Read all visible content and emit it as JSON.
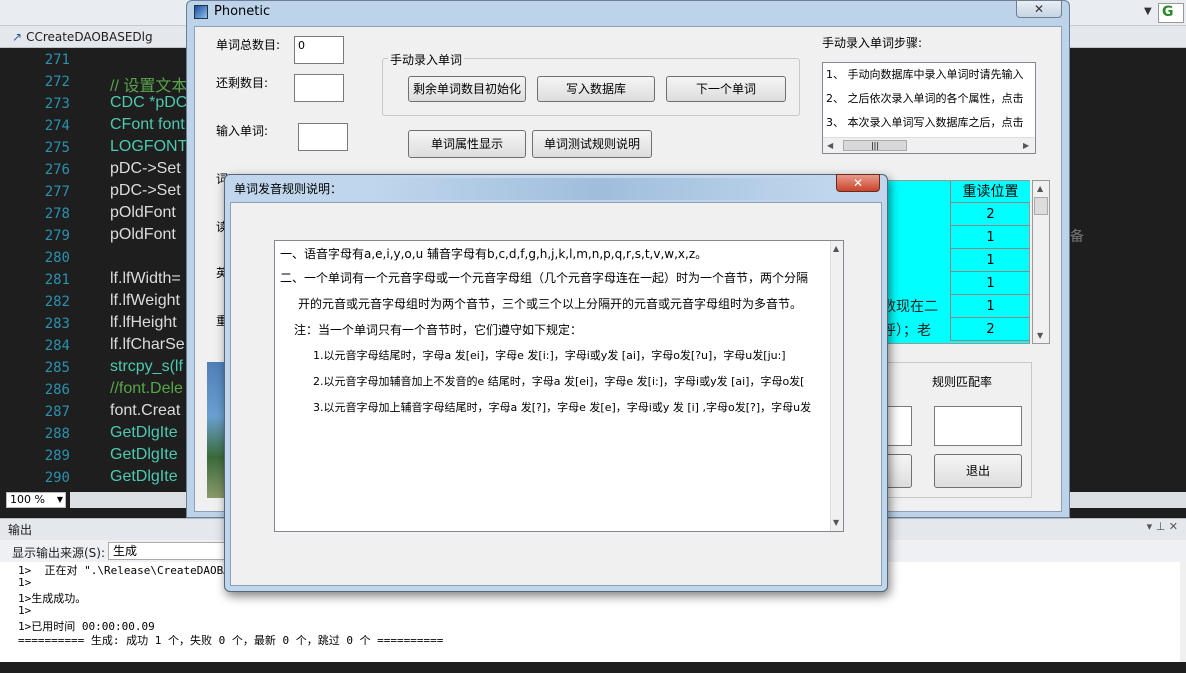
{
  "ide": {
    "file_tab": "CCreateDAOBASEDlg",
    "line_numbers": [
      "271",
      "272",
      "273",
      "274",
      "275",
      "276",
      "277",
      "278",
      "279",
      "280",
      "281",
      "282",
      "283",
      "284",
      "285",
      "286",
      "287",
      "288",
      "289",
      "290"
    ],
    "code_lines": [
      "",
      "// 设置文本",
      "CDC *pDC",
      "CFont font",
      "LOGFONT",
      "pDC->Set",
      "pDC->Set",
      "pOldFont",
      "pOldFont",
      "",
      "lf.lfWidth=",
      "lf.lfWeight",
      "lf.lfHeight",
      "lf.lfCharSe",
      "strcpy_s(lf",
      "//font.Dele",
      "font.Creat",
      "GetDlgIte",
      "GetDlgIte",
      "GetDlgIte"
    ],
    "zoom": "100 %",
    "right_hint": "备",
    "output": {
      "title": "输出",
      "controls": "▾ ⊥ ✕",
      "source_label": "显示输出来源(S):",
      "source_value": "生成",
      "lines": [
        "1>  正在对 \".\\Release\\CreateDAOBASE...",
        "1>",
        "1>生成成功。",
        "1>",
        "1>已用时间 00:00:00.09",
        "========== 生成: 成功 1 个，失败 0 个，最新 0 个，跳过 0 个 =========="
      ]
    }
  },
  "phonetic": {
    "title": "Phonetic",
    "close": "✕",
    "total_label": "单词总数目:",
    "total_value": "0",
    "remaining_label": "还剩数目:",
    "remaining_value": "",
    "input_label": "输入单词:",
    "input_value": "",
    "group_label": "手动录入单词",
    "btn_init": "剩余单词数目初始化",
    "btn_write": "写入数据库",
    "btn_next": "下一个单词",
    "btn_attr": "单词属性显示",
    "btn_rules": "单词测试规则说明",
    "steps_label": "手动录入单词步骤:",
    "steps": [
      "1、 手动向数据库中录入单词时请先输入",
      "2、 之后依次录入单词的各个属性，点击",
      "3、 本次录入单词写入数据库之后，点击"
    ],
    "grid_header": "重读位置",
    "grid_values": [
      "2",
      "1",
      "1",
      "1",
      "1",
      "2"
    ],
    "hidden_text": "数现在二",
    "hidden_text2": "呼）；老",
    "match_label": "规则匹配率",
    "match_value": "",
    "btn_exit": "退出"
  },
  "rule_dialog": {
    "title": "单词发音规则说明：",
    "close": "✕",
    "lines": [
      "一、语音字母有a,e,i,y,o,u 辅音字母有b,c,d,f,g,h,j,k,l,m,n,p,q,r,s,t,v,w,x,z。",
      "二、一个单词有一个元音字母或一个元音字母组（几个元音字母连在一起）时为一个音节，两个分隔",
      "开的元音或元音字母组时为两个音节，三个或三个以上分隔开的元音或元音字母组时为多音节。",
      "注：当一个单词只有一个音节时，它们遵守如下规定：",
      "1.以元音字母结尾时，字母a 发[ei]，字母e 发[i:]，字母i或y发 [ai]，字母o发[?u]，字母u发[ju:]",
      "2.以元音字母加辅音加上不发音的e 结尾时，字母a 发[ei]，字母e 发[i:]，字母i或y发 [ai]，字母o发[",
      "3.以元音字母加上辅音字母结尾时，字母a 发[?]，字母e 发[e]，字母i或y 发 [i] ,字母o发[?]，字母u发"
    ]
  }
}
